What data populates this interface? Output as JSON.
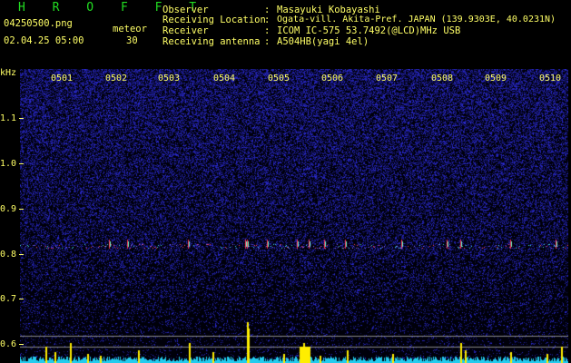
{
  "app": {
    "title": "H R O F F T"
  },
  "meta": {
    "filename": "04250500.png",
    "datetime": "02.04.25 05:00",
    "count_label": "meteor",
    "count_value": "30"
  },
  "station": [
    {
      "key": "Observer",
      "sep": ":",
      "value": "Masayuki Kobayashi"
    },
    {
      "key": "Receiving Location",
      "sep": ":",
      "value": "Ogata-vill. Akita-Pref. JAPAN (139.9303E, 40.0231N)"
    },
    {
      "key": "Receiver",
      "sep": ":",
      "value": "ICOM IC-575 53.7492(@LCD)MHz USB"
    },
    {
      "key": "Receiving antenna",
      "sep": ":",
      "value": "A504HB(yagi 4el)"
    }
  ],
  "axes": {
    "y_unit": "kHz",
    "y_ticks": [
      "1.1",
      "1.0",
      "0.9",
      "0.8",
      "0.7",
      "0.6"
    ],
    "x_ticks": [
      "0501",
      "0502",
      "0503",
      "0504",
      "0505",
      "0506",
      "0507",
      "0508",
      "0509",
      "0510"
    ]
  },
  "colors": {
    "background": "#000000",
    "text": "#ffff66",
    "title": "#22dd22",
    "noise": "#2a2aa0",
    "echo_band": "#ff5566",
    "level_trace": "#22ccee",
    "level_spikes": "#ffee00"
  }
}
